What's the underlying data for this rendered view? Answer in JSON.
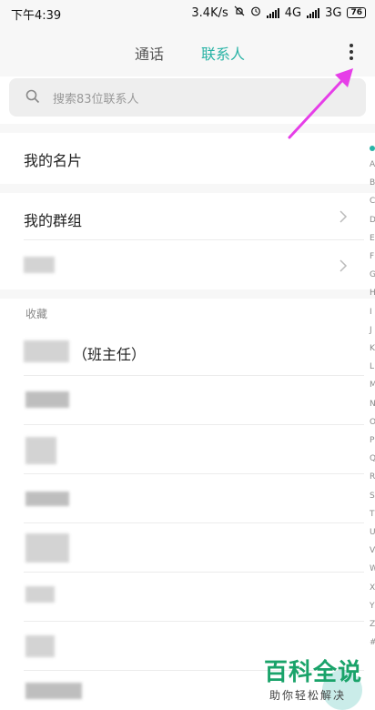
{
  "status_bar": {
    "time": "下午4:39",
    "net_speed": "3.4K/s",
    "network_1": "4G",
    "network_2": "3G",
    "battery": "76"
  },
  "tabs": [
    {
      "label": "通话",
      "active": false
    },
    {
      "label": "联系人",
      "active": true
    }
  ],
  "search": {
    "placeholder": "搜索83位联系人"
  },
  "my_card": {
    "label": "我的名片"
  },
  "groups": {
    "label": "我的群组"
  },
  "favorites": {
    "header": "收藏",
    "first_contact_suffix": "（班主任）"
  },
  "index_letters": [
    "A",
    "B",
    "C",
    "D",
    "E",
    "F",
    "G",
    "H",
    "I",
    "J",
    "K",
    "L",
    "M",
    "N",
    "O",
    "P",
    "Q",
    "R",
    "S",
    "T",
    "U",
    "V",
    "W",
    "X",
    "Y",
    "Z",
    "#"
  ],
  "watermark": {
    "title": "百科全说",
    "subtitle": "助你轻松解决"
  },
  "colors": {
    "accent": "#2ab3a6",
    "annotation_arrow": "#e63ee8",
    "watermark": "#1aa36a"
  }
}
